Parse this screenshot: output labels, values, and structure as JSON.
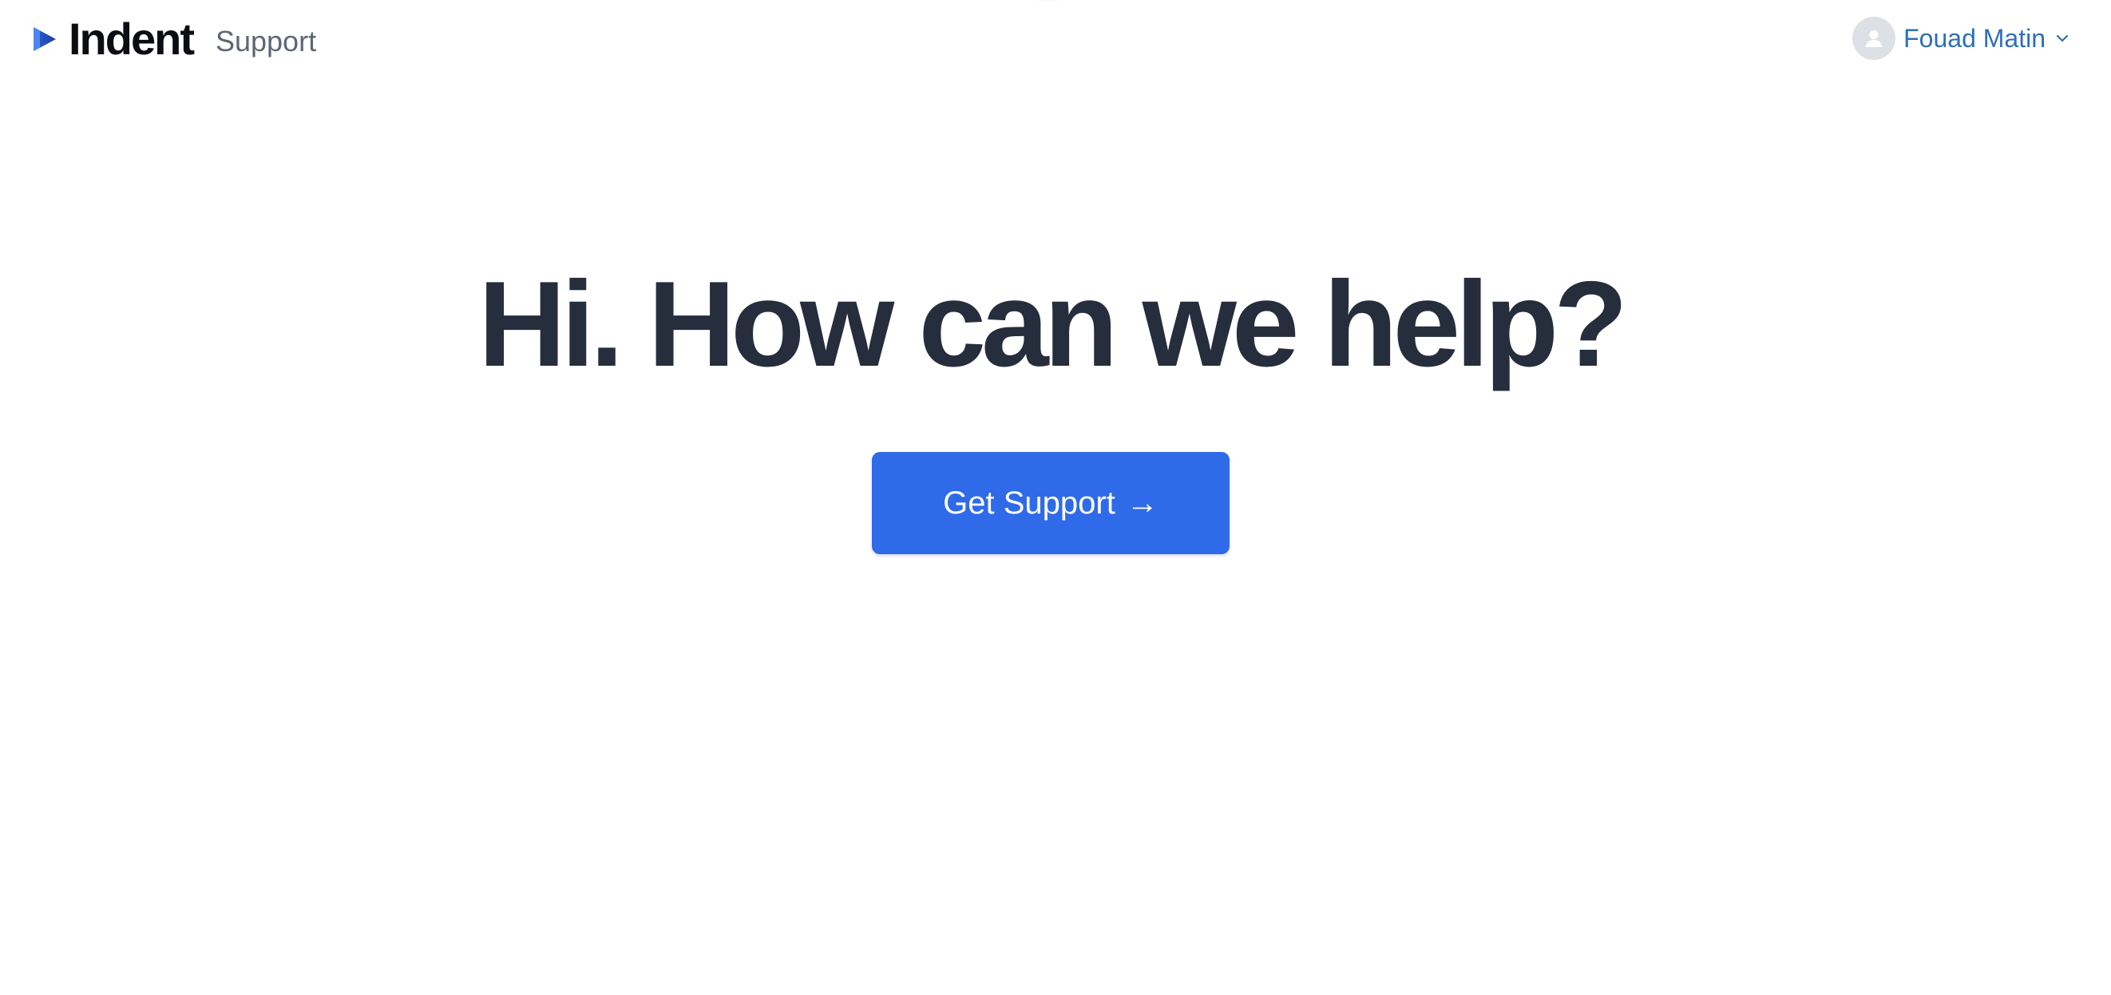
{
  "header": {
    "brand_name": "Indent",
    "brand_sub": "Support",
    "user_name": "Fouad Matin",
    "logo_icon": "play-triangle-icon",
    "avatar_icon": "user-icon",
    "menu_icon": "chevron-down-icon"
  },
  "hero": {
    "title": "Hi. How can we help?",
    "cta_label": "Get Support",
    "cta_arrow": "→"
  },
  "colors": {
    "accent": "#2f6be8",
    "title": "#262d3d",
    "user_link": "#2f6fb6",
    "brand_text": "#0b0d12",
    "muted": "#5f6673"
  }
}
